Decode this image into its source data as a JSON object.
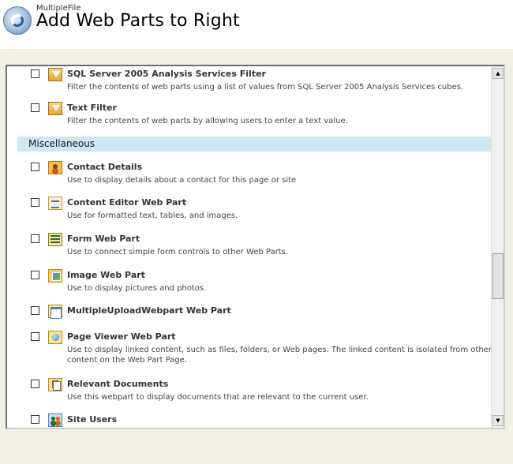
{
  "header": {
    "site_name": "MultipleFile",
    "page_title": "Add Web Parts to Right"
  },
  "section": {
    "label": "Miscellaneous"
  },
  "items": [
    {
      "title": "SQL Server 2005 Analysis Services Filter",
      "desc": "Filter the contents of web parts using a list of values from SQL Server 2005 Analysis Services cubes.",
      "icon": "filter-icon",
      "checked": false
    },
    {
      "title": "Text Filter",
      "desc": "Filter the contents of web parts by allowing users to enter a text value.",
      "icon": "filter-icon",
      "checked": false
    },
    {
      "title": "Contact Details",
      "desc": "Use to display details about a contact for this page or site",
      "icon": "contact-icon",
      "checked": false
    },
    {
      "title": "Content Editor Web Part",
      "desc": "Use for formatted text, tables, and images.",
      "icon": "content-editor-icon",
      "checked": false
    },
    {
      "title": "Form Web Part",
      "desc": "Use to connect simple form controls to other Web Parts.",
      "icon": "form-icon",
      "checked": false
    },
    {
      "title": "Image Web Part",
      "desc": "Use to display pictures and photos.",
      "icon": "image-icon",
      "checked": false
    },
    {
      "title": "MultipleUploadWebpart Web Part",
      "desc": "",
      "icon": "web-part-icon",
      "checked": false
    },
    {
      "title": "Page Viewer Web Part",
      "desc": "Use to display linked content, such as files, folders, or Web pages. The linked content is isolated from other content on the Web Part Page.",
      "icon": "page-viewer-icon",
      "checked": false
    },
    {
      "title": "Relevant Documents",
      "desc": "Use this webpart to display documents that are relevant to the current user.",
      "icon": "documents-icon",
      "checked": false
    },
    {
      "title": "Site Users",
      "desc": "",
      "icon": "site-users-icon",
      "checked": false
    }
  ],
  "scrollbar": {
    "up_glyph": "▲",
    "down_glyph": "▼"
  }
}
